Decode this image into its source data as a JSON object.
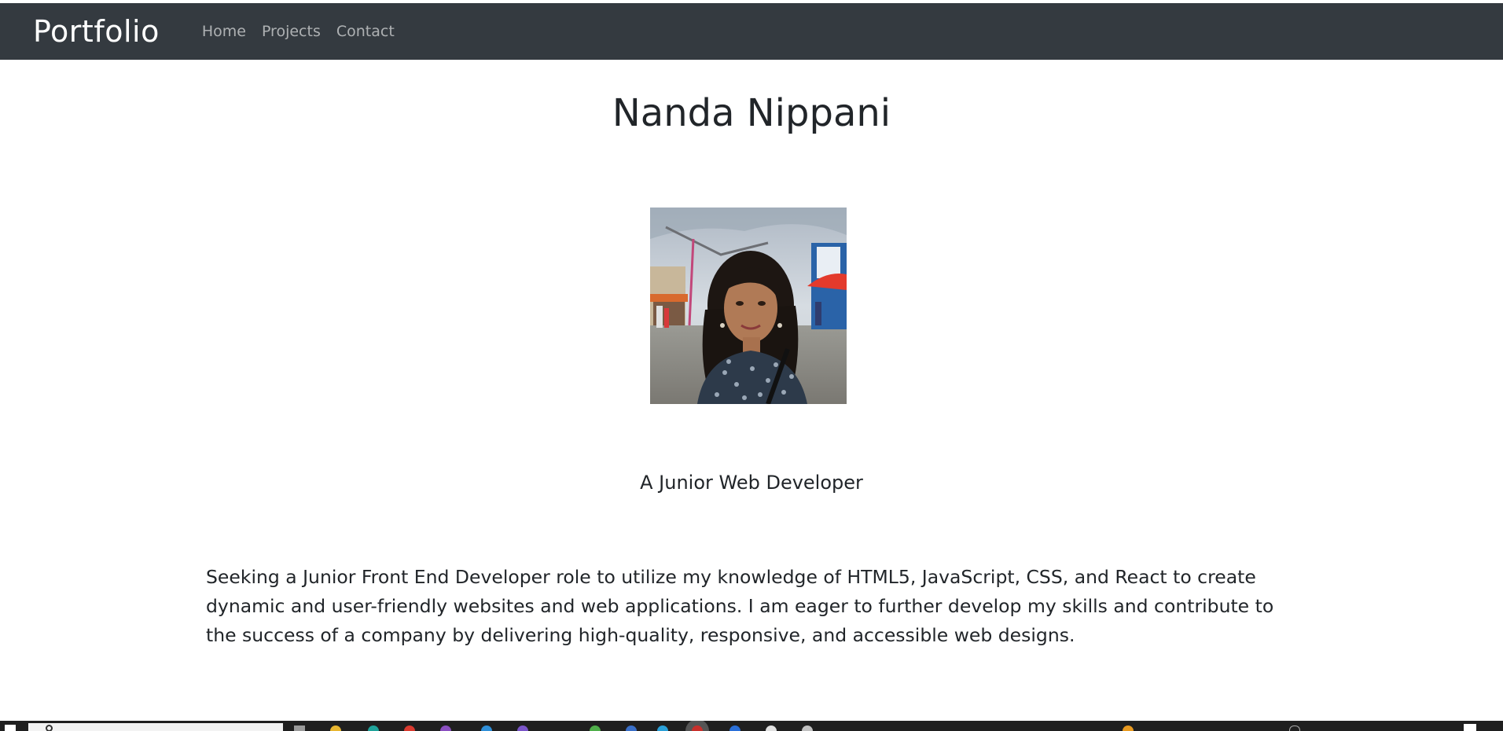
{
  "navbar": {
    "brand": "Portfolio",
    "links": [
      "Home",
      "Projects",
      "Contact"
    ]
  },
  "profile": {
    "name": "Nanda Nippani",
    "photo_alt": "Profile photo",
    "subtitle": "A Junior Web Developer",
    "summary": "Seeking a Junior Front End Developer role to utilize my knowledge of HTML5, JavaScript, CSS, and React to create dynamic and user-friendly websites and web applications. I am eager to further develop my skills and contribute to the success of a company by delivering high-quality, responsive, and accessible web designs."
  },
  "colors": {
    "navbar_bg": "#343a40",
    "brand": "#ffffff",
    "nav_link": "rgba(255,255,255,0.6)",
    "text": "#212529",
    "taskbar": "#1f1f1f"
  },
  "taskbar": {
    "icons": [
      "task-view-icon",
      "file-explorer-icon",
      "edge-icon",
      "chrome-icon",
      "vscode-icon",
      "app-icon",
      "app-icon",
      "app-icon",
      "app-icon",
      "app-icon",
      "app-icon",
      "app-icon"
    ]
  }
}
